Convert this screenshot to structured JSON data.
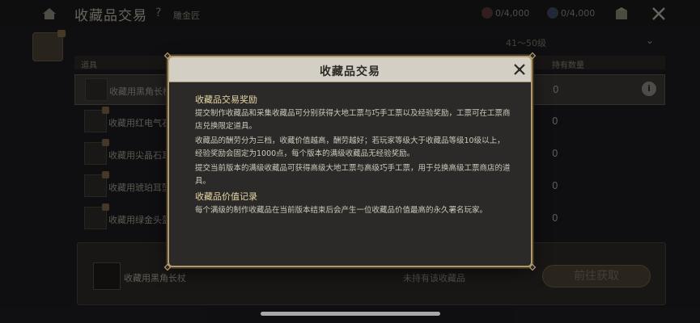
{
  "topbar": {
    "title": "收藏品交易",
    "help": "?",
    "subtitle": "雕金匠",
    "currency1": "0/4,000",
    "currency2": "0/4,000"
  },
  "filter": {
    "level": "41～50级"
  },
  "table": {
    "headers": {
      "item": "道具",
      "qty": "持有数量"
    },
    "rows": [
      {
        "name": "收藏用黑角长杖",
        "qty": "0",
        "selected": true
      },
      {
        "name": "收藏用红电气石",
        "qty": "0"
      },
      {
        "name": "收藏用尖晶石耳",
        "qty": "0"
      },
      {
        "name": "收藏用琥珀耳坠",
        "qty": "0"
      },
      {
        "name": "收藏用绿金头盔",
        "qty": "0"
      }
    ]
  },
  "bottom": {
    "item_name": "收藏用黑角长杖",
    "status": "未持有该收藏品",
    "button": "前往获取"
  },
  "modal": {
    "title": "收藏品交易",
    "section1_title": "收藏品交易奖励",
    "p1": "提交制作收藏品和采集收藏品可分别获得大地工票与巧手工票以及经验奖励，工票可在工票商店兑换限定道具。",
    "p2": "收藏品的酬劳分为三档，收藏价值越高，酬劳越好；若玩家等级大于收藏品等级10级以上，经验奖励会固定为1000点，每个版本的满级收藏品无经验奖励。",
    "p3": "提交当前版本的满级收藏品可获得高级大地工票与高级巧手工票，用于兑换高级工票商店的道具。",
    "section2_title": "收藏品价值记录",
    "p4": "每个满级的制作收藏品在当前版本结束后会产生一位收藏品价值最高的永久署名玩家。"
  },
  "colors": {
    "accent_gold": "#b39a68",
    "modal_bg": "#2b2a28",
    "heading": "#e8d7a8"
  }
}
